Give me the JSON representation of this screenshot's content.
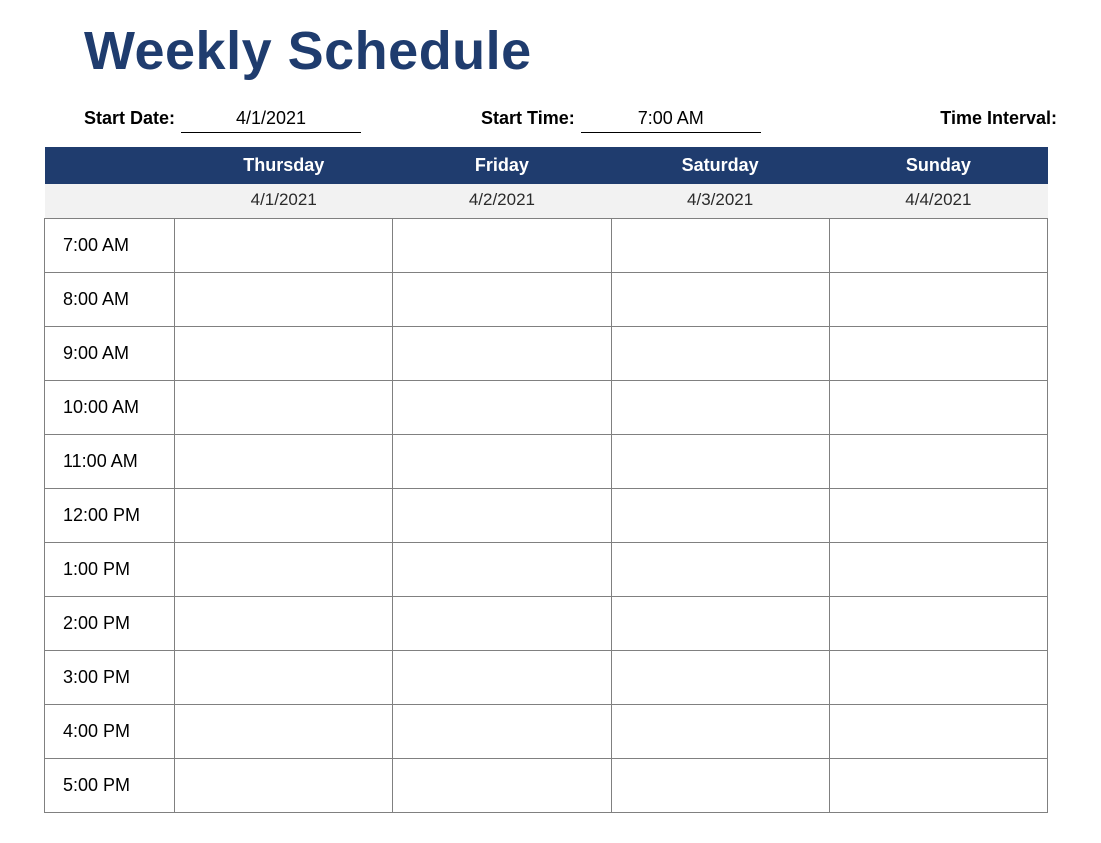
{
  "title": "Weekly Schedule",
  "meta": {
    "start_date_label": "Start Date:",
    "start_date_value": "4/1/2021",
    "start_time_label": "Start Time:",
    "start_time_value": "7:00 AM",
    "time_interval_label": "Time Interval:"
  },
  "days": [
    {
      "name": "Thursday",
      "date": "4/1/2021"
    },
    {
      "name": "Friday",
      "date": "4/2/2021"
    },
    {
      "name": "Saturday",
      "date": "4/3/2021"
    },
    {
      "name": "Sunday",
      "date": "4/4/2021"
    }
  ],
  "times": [
    "7:00 AM",
    "8:00 AM",
    "9:00 AM",
    "10:00 AM",
    "11:00 AM",
    "12:00 PM",
    "1:00 PM",
    "2:00 PM",
    "3:00 PM",
    "4:00 PM",
    "5:00 PM"
  ],
  "colors": {
    "header_bg": "#1f3c6e",
    "subheader_bg": "#f2f2f2",
    "grid_border": "#808080"
  }
}
